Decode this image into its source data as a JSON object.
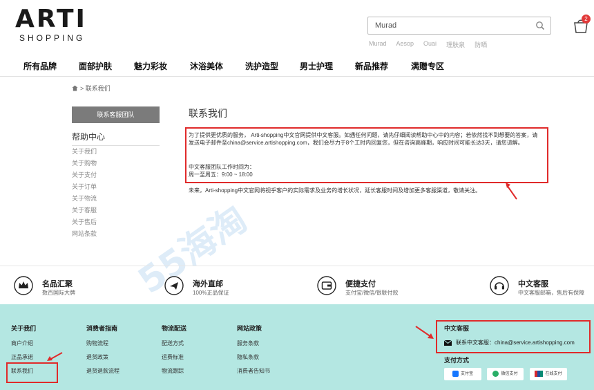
{
  "header": {
    "logo_main": "ARTI",
    "logo_sub": "SHOPPING",
    "search_value": "Murad",
    "hot_words": [
      "Murad",
      "Aesop",
      "Ouai",
      "理肤泉",
      "防晒"
    ],
    "cart_count": "2"
  },
  "nav": [
    "所有品牌",
    "面部护肤",
    "魅力彩妆",
    "沐浴美体",
    "洗护造型",
    "男士护理",
    "新品推荐",
    "满赠专区"
  ],
  "breadcrumb": "> 联系我们",
  "sidebar": {
    "button": "联系客服团队",
    "title": "帮助中心",
    "links": [
      "关于我们",
      "关于购物",
      "关于支付",
      "关于订单",
      "关于物流",
      "关于客服",
      "关于售后",
      "网站条款"
    ]
  },
  "main": {
    "title": "联系我们",
    "intro": "为了提供更优质的服务， Arti-shopping中文官网提供中文客服。如遇任何问题，请先仔细阅读帮助中心中的内容；若依然找不到想要的答案，请发送电子邮件至china@service.artishopping.com，我们会尽力于8个工时内回复您，但在咨询高峰期，响应时间可能长达3天，请您谅解。",
    "hours_title": "中文客服团队工作时间为：",
    "hours": "周一至周五：9:00 ~ 18:00",
    "future": "未来，Arti-shopping中文官网将视乎客户的实际需求及业务的增长状况，延长客服时间及增加更多客服渠道，敬请关注。"
  },
  "features": [
    {
      "icon": "crown-icon",
      "title": "名品汇聚",
      "sub": "数百国际大牌"
    },
    {
      "icon": "plane-icon",
      "title": "海外直邮",
      "sub": "100%正品保证"
    },
    {
      "icon": "wallet-icon",
      "title": "便捷支付",
      "sub": "支付宝/微信/银联付款"
    },
    {
      "icon": "headset-icon",
      "title": "中文客服",
      "sub": "中文客服邮箱，售后有保障"
    }
  ],
  "footer": {
    "columns": [
      {
        "title": "关于我们",
        "links": [
          "商户介绍",
          "正品承诺",
          "联系我们"
        ]
      },
      {
        "title": "消费者指南",
        "links": [
          "购物流程",
          "退货政策",
          "退货退款流程"
        ]
      },
      {
        "title": "物流配送",
        "links": [
          "配送方式",
          "运费标准",
          "物流跟踪"
        ]
      },
      {
        "title": "网站政策",
        "links": [
          "服务条款",
          "隐私条款",
          "消费者告知书"
        ]
      }
    ],
    "service_title": "中文客服",
    "service_email": "联系中文客服：china@service.artishopping.com",
    "payment_title": "支付方式",
    "payments": [
      "支付宝",
      "微信支付",
      "在线支付"
    ]
  },
  "watermark": "55海淘",
  "colors": {
    "accent_red": "#e02a2a",
    "footer_bg": "#b4e7e2",
    "sidebar_btn": "#7b7b7b"
  }
}
